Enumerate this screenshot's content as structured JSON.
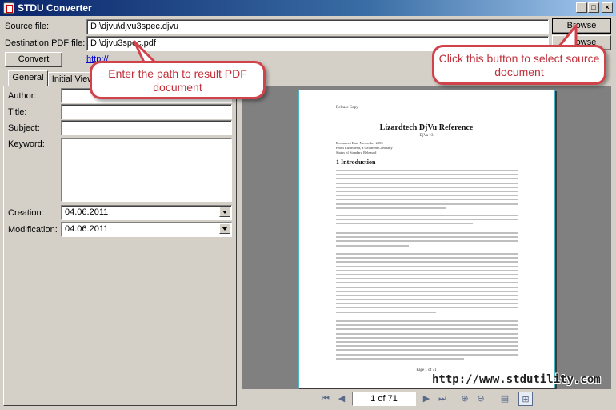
{
  "window": {
    "title": "STDU Converter",
    "controls": [
      "_",
      "□",
      "×"
    ]
  },
  "source": {
    "label": "Source file:",
    "value": "D:\\djvu\\djvu3spec.djvu",
    "browse_label": "Browse"
  },
  "destination": {
    "label": "Destination PDF file:",
    "value": "D:\\djvu3spec.pdf",
    "browse_label": "Browse"
  },
  "convert_label": "Convert",
  "link_text": "http://",
  "tabs": [
    {
      "label": "General",
      "active": true
    },
    {
      "label": "Initial View",
      "active": false
    }
  ],
  "metadata": {
    "author_label": "Author:",
    "title_label": "Title:",
    "subject_label": "Subject:",
    "keyword_label": "Keyword:",
    "creation_label": "Creation:",
    "creation_value": "04.06.2011",
    "modification_label": "Modification:",
    "modification_value": "04.06.2011"
  },
  "preview": {
    "release_copy": "Release Copy",
    "doc_title": "Lizardtech DjVu Reference",
    "doc_subtitle": "DjVu v3",
    "meta_lines": [
      "Document Date    November 2005",
      "From             Lizardtech, a Celartem Company",
      "Status of Standard   Released"
    ],
    "section_heading": "1   Introduction",
    "page_footer": "Page 1 of 71"
  },
  "navigation": {
    "page_indicator": "1 of 71"
  },
  "watermark": "http://www.stdutility.com",
  "callouts": {
    "path": "Enter the path to result PDF document",
    "browse": "Click this button to select source document"
  },
  "colors": {
    "titlebar": "#0a246a",
    "callout_border": "#d2424a",
    "callout_text": "#c0303a",
    "page_edge": "#4fb3c6"
  }
}
